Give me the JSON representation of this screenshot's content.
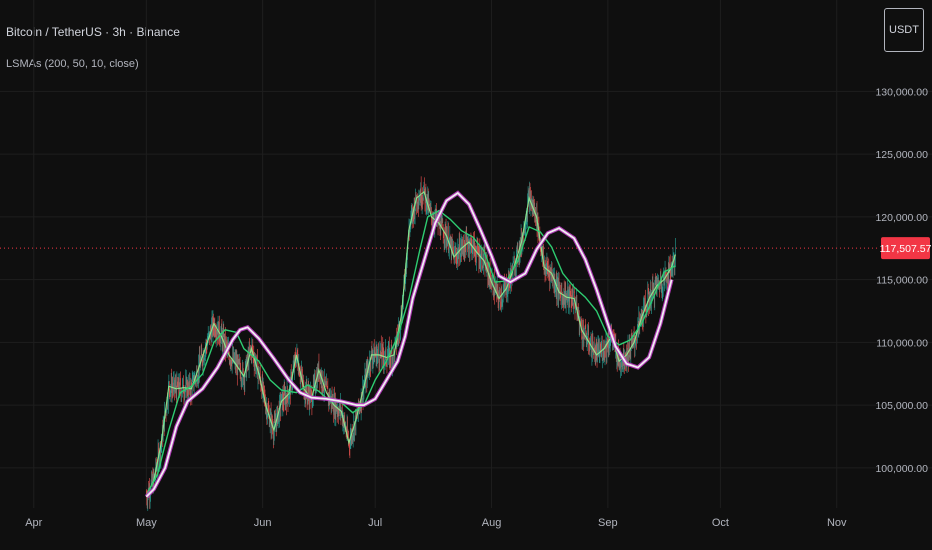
{
  "header": {
    "symbol": "Bitcoin / TetherUS · 3h · Binance",
    "study": "LSMAs (200, 50, 10, close)",
    "currency": "USDT"
  },
  "price_tag": {
    "value_label": "117,507.57",
    "color": "#f23645"
  },
  "colors": {
    "background": "#0f0f0f",
    "grid": "#1e1e1e",
    "up_candle": "#26a69a",
    "down_candle": "#ef5350",
    "lsma_200": "#f0f0f0",
    "lsma_200_glow": "#c040c8",
    "lsma_50": "#2ecc71",
    "lsma_10": "#90ee90",
    "axis_text": "#b2b5be",
    "current_price_line": "#f23645"
  },
  "chart_data": {
    "type": "line",
    "title": "",
    "x_axis": {
      "labels": [
        "Apr",
        "May",
        "Jun",
        "Jul",
        "Aug",
        "Sep",
        "Oct",
        "Nov"
      ],
      "label_dates": [
        "2025-04-01",
        "2025-05-01",
        "2025-06-01",
        "2025-07-01",
        "2025-08-01",
        "2025-09-01",
        "2025-10-01",
        "2025-11-01"
      ],
      "range": [
        "2025-03-23",
        "2025-11-12"
      ]
    },
    "y_axis": {
      "ticks": [
        100000,
        105000,
        110000,
        115000,
        120000,
        125000,
        130000
      ],
      "tick_labels": [
        "100,000.00",
        "105,000.00",
        "110,000.00",
        "115,000.00",
        "120,000.00",
        "125,000.00",
        "130,000.00"
      ],
      "range": [
        97600,
        132500
      ],
      "position": "right"
    },
    "grid": true,
    "current_price": 117507.57,
    "series": [
      {
        "key": "lsma200",
        "x": [
          "2025-05-01",
          "2025-05-03",
          "2025-05-06",
          "2025-05-09",
          "2025-05-12",
          "2025-05-16",
          "2025-05-20",
          "2025-05-24",
          "2025-05-26",
          "2025-05-28",
          "2025-05-31",
          "2025-06-04",
          "2025-06-08",
          "2025-06-11",
          "2025-06-14",
          "2025-06-18",
          "2025-06-22",
          "2025-06-26",
          "2025-06-28",
          "2025-07-01",
          "2025-07-04",
          "2025-07-07",
          "2025-07-09",
          "2025-07-11",
          "2025-07-14",
          "2025-07-17",
          "2025-07-20",
          "2025-07-23",
          "2025-07-26",
          "2025-07-29",
          "2025-08-01",
          "2025-08-03",
          "2025-08-06",
          "2025-08-10",
          "2025-08-13",
          "2025-08-16",
          "2025-08-19",
          "2025-08-23",
          "2025-08-26",
          "2025-08-29",
          "2025-09-01",
          "2025-09-03",
          "2025-09-06",
          "2025-09-09",
          "2025-09-12",
          "2025-09-15",
          "2025-09-18"
        ],
        "values": [
          97700,
          98300,
          100000,
          103300,
          105300,
          106300,
          108000,
          110200,
          111000,
          111200,
          110300,
          108700,
          107000,
          106000,
          105600,
          105500,
          105300,
          105000,
          105000,
          105500,
          107000,
          108500,
          110500,
          113500,
          116500,
          119500,
          121300,
          121900,
          121000,
          119000,
          116900,
          115300,
          114800,
          115500,
          117400,
          118700,
          119100,
          118300,
          116600,
          114200,
          111500,
          109700,
          108300,
          108000,
          108800,
          111500,
          115000
        ]
      },
      {
        "key": "lsma50",
        "x": [
          "2025-05-01",
          "2025-05-04",
          "2025-05-07",
          "2025-05-10",
          "2025-05-13",
          "2025-05-16",
          "2025-05-19",
          "2025-05-22",
          "2025-05-25",
          "2025-05-27",
          "2025-05-31",
          "2025-06-03",
          "2025-06-06",
          "2025-06-10",
          "2025-06-13",
          "2025-06-16",
          "2025-06-19",
          "2025-06-22",
          "2025-06-25",
          "2025-06-28",
          "2025-07-01",
          "2025-07-04",
          "2025-07-07",
          "2025-07-10",
          "2025-07-13",
          "2025-07-15",
          "2025-07-18",
          "2025-07-21",
          "2025-07-24",
          "2025-07-27",
          "2025-07-30",
          "2025-08-02",
          "2025-08-05",
          "2025-08-08",
          "2025-08-11",
          "2025-08-14",
          "2025-08-17",
          "2025-08-20",
          "2025-08-23",
          "2025-08-26",
          "2025-08-29",
          "2025-09-01",
          "2025-09-04",
          "2025-09-07",
          "2025-09-10",
          "2025-09-13",
          "2025-09-16",
          "2025-09-19"
        ],
        "values": [
          97800,
          99500,
          103000,
          106000,
          106500,
          107500,
          110000,
          111000,
          110800,
          109500,
          108500,
          107000,
          106200,
          106000,
          106600,
          106100,
          105300,
          105200,
          104400,
          105000,
          107000,
          108500,
          110500,
          113500,
          117500,
          120000,
          120500,
          119800,
          118900,
          118400,
          117300,
          114800,
          114900,
          116500,
          119200,
          118800,
          117600,
          115500,
          114400,
          113600,
          112500,
          110500,
          109800,
          110200,
          111500,
          113500,
          115600,
          116100
        ]
      },
      {
        "key": "lsma10",
        "x": [
          "2025-05-01",
          "2025-05-03",
          "2025-05-05",
          "2025-05-07",
          "2025-05-09",
          "2025-05-11",
          "2025-05-13",
          "2025-05-15",
          "2025-05-17",
          "2025-05-19",
          "2025-05-21",
          "2025-05-23",
          "2025-05-25",
          "2025-05-27",
          "2025-05-29",
          "2025-05-31",
          "2025-06-02",
          "2025-06-04",
          "2025-06-06",
          "2025-06-08",
          "2025-06-10",
          "2025-06-12",
          "2025-06-14",
          "2025-06-16",
          "2025-06-18",
          "2025-06-20",
          "2025-06-22",
          "2025-06-24",
          "2025-06-26",
          "2025-06-28",
          "2025-06-30",
          "2025-07-02",
          "2025-07-04",
          "2025-07-06",
          "2025-07-08",
          "2025-07-10",
          "2025-07-12",
          "2025-07-14",
          "2025-07-16",
          "2025-07-18",
          "2025-07-20",
          "2025-07-22",
          "2025-07-24",
          "2025-07-26",
          "2025-07-28",
          "2025-07-30",
          "2025-08-01",
          "2025-08-03",
          "2025-08-05",
          "2025-08-07",
          "2025-08-09",
          "2025-08-11",
          "2025-08-13",
          "2025-08-15",
          "2025-08-17",
          "2025-08-19",
          "2025-08-21",
          "2025-08-23",
          "2025-08-25",
          "2025-08-27",
          "2025-08-29",
          "2025-08-31",
          "2025-09-02",
          "2025-09-04",
          "2025-09-06",
          "2025-09-08",
          "2025-09-10",
          "2025-09-12",
          "2025-09-14",
          "2025-09-16",
          "2025-09-18",
          "2025-09-19"
        ],
        "values": [
          97800,
          99000,
          102000,
          106500,
          106300,
          106400,
          106300,
          108000,
          109800,
          111500,
          110500,
          109000,
          108200,
          107300,
          109500,
          107500,
          104800,
          103000,
          105300,
          105900,
          109000,
          106300,
          105500,
          107800,
          106000,
          105000,
          104500,
          102000,
          104000,
          106500,
          109000,
          109000,
          108800,
          109000,
          112200,
          119000,
          121500,
          122000,
          120000,
          119500,
          118500,
          116800,
          117500,
          118000,
          117200,
          116500,
          114800,
          113500,
          114300,
          116000,
          118000,
          121500,
          120000,
          116000,
          115500,
          114000,
          113600,
          113500,
          111000,
          110000,
          109000,
          109500,
          110500,
          108500,
          109000,
          110000,
          112000,
          113500,
          114500,
          115000,
          116000,
          117000
        ]
      }
    ],
    "price_path": {
      "x": [
        "2025-05-01",
        "2025-05-03",
        "2025-05-05",
        "2025-05-07",
        "2025-05-09",
        "2025-05-11",
        "2025-05-13",
        "2025-05-15",
        "2025-05-17",
        "2025-05-19",
        "2025-05-21",
        "2025-05-23",
        "2025-05-25",
        "2025-05-27",
        "2025-05-29",
        "2025-05-31",
        "2025-06-02",
        "2025-06-04",
        "2025-06-06",
        "2025-06-08",
        "2025-06-10",
        "2025-06-12",
        "2025-06-14",
        "2025-06-16",
        "2025-06-18",
        "2025-06-20",
        "2025-06-22",
        "2025-06-24",
        "2025-06-26",
        "2025-06-28",
        "2025-06-30",
        "2025-07-02",
        "2025-07-04",
        "2025-07-06",
        "2025-07-08",
        "2025-07-10",
        "2025-07-12",
        "2025-07-14",
        "2025-07-16",
        "2025-07-18",
        "2025-07-20",
        "2025-07-22",
        "2025-07-24",
        "2025-07-26",
        "2025-07-28",
        "2025-07-30",
        "2025-08-01",
        "2025-08-03",
        "2025-08-05",
        "2025-08-07",
        "2025-08-09",
        "2025-08-11",
        "2025-08-13",
        "2025-08-15",
        "2025-08-17",
        "2025-08-19",
        "2025-08-21",
        "2025-08-23",
        "2025-08-25",
        "2025-08-27",
        "2025-08-29",
        "2025-08-31",
        "2025-09-02",
        "2025-09-04",
        "2025-09-06",
        "2025-09-08",
        "2025-09-10",
        "2025-09-12",
        "2025-09-14",
        "2025-09-16",
        "2025-09-18",
        "2025-09-19"
      ],
      "values": [
        97800,
        99000,
        102000,
        106500,
        106300,
        106400,
        106300,
        108000,
        109800,
        111500,
        110500,
        109000,
        108200,
        107300,
        109500,
        107500,
        104800,
        103000,
        105300,
        105900,
        109000,
        106300,
        105500,
        107800,
        106000,
        105000,
        104500,
        102000,
        104000,
        106500,
        109000,
        109000,
        108800,
        109000,
        112200,
        119000,
        121500,
        122000,
        120000,
        119500,
        118500,
        116800,
        117500,
        118000,
        117200,
        116500,
        114800,
        113500,
        114300,
        116000,
        118000,
        121500,
        120000,
        116000,
        115500,
        114000,
        113600,
        113500,
        111000,
        110000,
        109000,
        109500,
        110500,
        108500,
        109000,
        110000,
        112000,
        113500,
        114500,
        115000,
        116000,
        117000
      ]
    }
  }
}
